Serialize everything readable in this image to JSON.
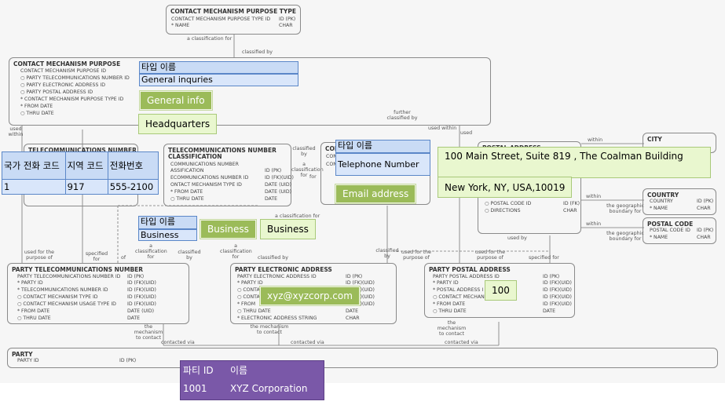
{
  "entities": {
    "cmpt": {
      "title": "CONTACT MECHANISM PURPOSE TYPE",
      "rows": [
        [
          "CONTACT MECHANISM PURPOSE TYPE ID",
          "ID (PK)"
        ],
        [
          "* NAME",
          "CHAR"
        ]
      ]
    },
    "cmp": {
      "title": "CONTACT MECHANISM PURPOSE",
      "rows": [
        "CONTACT MECHANISM PURPOSE ID",
        "○ PARTY TELECOMMUNICATIONS NUMBER ID",
        "○ PARTY ELECTRONIC ADDRESS ID",
        "○ PARTY POSTAL ADDRESS ID",
        "* CONTACT MECHANISM PURPOSE TYPE ID",
        "* FROM DATE",
        "○ THRU DATE"
      ]
    },
    "tn": {
      "title": "TELECOMMUNICATIONS NUMBER"
    },
    "tnc": {
      "title": "TELECOMMUNICATIONS NUMBER",
      "subtitle": "CLASSIFICATION",
      "rows": [
        [
          "COMMUNICATIONS NUMBER",
          "ID (PK)"
        ],
        [
          "ASSIFICATION",
          "ID (FK)(UID)"
        ],
        [
          "ECOMMUNICATIONS NUMBER ID",
          "ID (FK)(UID)"
        ],
        [
          "ONTACT MECHANISM TYPE ID",
          "DATE (UID)"
        ],
        [
          "* FROM DATE",
          "DATE (UID)"
        ],
        [
          "○ THRU DATE",
          "DATE"
        ]
      ]
    },
    "con": {
      "title": "CON",
      "rows": [
        "CONT",
        "CONT",
        "ELEC"
      ]
    },
    "postal": {
      "title": "POSTAL ADDRESS",
      "rows": [
        [
          "○ POSTAL CODE ID",
          "ID (FK)"
        ],
        [
          "○ DIRECTIONS",
          "CHAR"
        ]
      ]
    },
    "city": {
      "title": "CITY",
      "rows": [
        [
          "CITY ID",
          "ID (PK)"
        ],
        [
          "* NAME",
          "CHAR"
        ]
      ]
    },
    "country": {
      "title": "COUNTRY",
      "rows": [
        [
          "COUNTRY",
          "ID (PK)"
        ],
        [
          "* NAME",
          "CHAR"
        ]
      ]
    },
    "postalcode": {
      "title": "POSTAL CODE",
      "rows": [
        [
          "POSTAL CODE ID",
          "ID (PK)"
        ],
        [
          "* NAME",
          "CHAR"
        ]
      ]
    },
    "ptn": {
      "title": "PARTY TELECOMMUNICATIONS NUMBER",
      "rows": [
        [
          "PARTY TELECOMMUNICATIONS NUMBER ID",
          "ID (PK)"
        ],
        [
          "* PARTY ID",
          "ID (FK)(UID)"
        ],
        [
          "* TELECOMMUNICATIONS NUMBER ID",
          "ID (FK)(UID)"
        ],
        [
          "○ CONTACT MECHANISM TYPE ID",
          "ID (FK)(UID)"
        ],
        [
          "○ CONTACT MECHANISM USAGE TYPE ID",
          "ID (FK)(UID)"
        ],
        [
          "* FROM DATE",
          "DATE (UID)"
        ],
        [
          "○ THRU DATE",
          "DATE"
        ]
      ]
    },
    "pea": {
      "title": "PARTY ELECTRONIC ADDRESS",
      "rows": [
        [
          "PARTY ELECTRONIC ADDRESS ID",
          "ID (PK)"
        ],
        [
          "* PARTY ID",
          "ID (FK)(UID)"
        ],
        [
          "○ CONTA",
          "ID (FK)(UID)"
        ],
        [
          "○ CONTA",
          "ID (FK)(UID)"
        ],
        [
          "* FROM",
          "ID (FK)(UID)"
        ],
        [
          "○ THRU DATE",
          "DATE"
        ],
        [
          "* ELECTRONIC ADDRESS STRING",
          "CHAR"
        ]
      ]
    },
    "ppa": {
      "title": "PARTY POSTAL ADDRESS",
      "rows": [
        [
          "PARTY POSTAL ADDRESS ID",
          "ID (PK)"
        ],
        [
          "* PARTY ID",
          "ID (FK)(UID)"
        ],
        [
          "* POSTAL ADDRESS I",
          "ID (FK)(UID)"
        ],
        [
          "○ CONTACT MECHANI",
          "ID (FK)(UID)"
        ],
        [
          "* FROM DATE",
          "ID (FK)(UID)"
        ],
        [
          "○ THRU DATE",
          "DATE"
        ]
      ]
    },
    "party": {
      "title": "PARTY",
      "rows": [
        [
          "PARTY ID",
          "ID (PK)"
        ]
      ]
    }
  },
  "rel_labels": {
    "a_class_for": "a classification for",
    "classified_by": "classified by",
    "used_within": "used within",
    "further": "further classified by",
    "a_class": "a classification for",
    "classif": "classified by",
    "used_for_purpose": "used for the purpose of",
    "specified_for": "specified for",
    "of": "of",
    "used": "used",
    "used_by": "used by",
    "within": "within",
    "geo_boundary": "the geographic boundary for",
    "mechanism_to_contact": "the mechanism to contact",
    "contacted_via": "contacted via",
    "used_within2": "used within",
    "classifi": "classified by",
    "for": "for"
  },
  "overlays": {
    "type_name_1": {
      "header": "타입 이름",
      "value": "General inquries"
    },
    "general_info": "General   info",
    "headquarters": "Headquarters",
    "phone_table": {
      "headers": [
        "국가 전화 코드",
        "지역 코드",
        "전화번호"
      ],
      "values": [
        "1",
        "917",
        "555-2100"
      ]
    },
    "type_name_2": {
      "header": "타입 이름",
      "value": "Telephone Number"
    },
    "address_line1": "100  Main  Street,  Suite  819 , The   Coalman Building",
    "address_line2": "New York, NY, USA,10019",
    "email_address": "Email   address",
    "type_name_3": {
      "header": "타입 이름",
      "value": "Business"
    },
    "business_dark": "Business",
    "business_light": "Business",
    "email_value": "xyz@xyzcorp.com",
    "postal_value": "100",
    "party_table": {
      "headers": [
        "파티 ID",
        "이름"
      ],
      "values": [
        "1001",
        "XYZ Corporation"
      ]
    }
  }
}
